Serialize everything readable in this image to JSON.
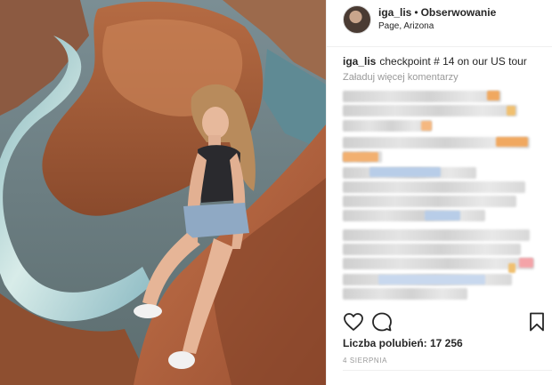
{
  "post": {
    "username": "iga_lis",
    "separator": "•",
    "follow_label": "Obserwowanie",
    "location": "Page, Arizona",
    "caption_text": "checkpoint # 14 on our US tour",
    "load_more_label": "Załaduj więcej komentarzy",
    "likes_label": "Liczba polubień: 17 256",
    "date_label": "4 SIERPNIA"
  },
  "icons": {
    "like": "heart-icon",
    "comment": "comment-icon",
    "save": "bookmark-icon"
  },
  "colors": {
    "text": "#262626",
    "muted": "#999999",
    "divider": "#efefef",
    "blur_orange": "#f0a860",
    "blur_blue": "#b8cde8",
    "blur_pink": "#f4a3a8"
  }
}
